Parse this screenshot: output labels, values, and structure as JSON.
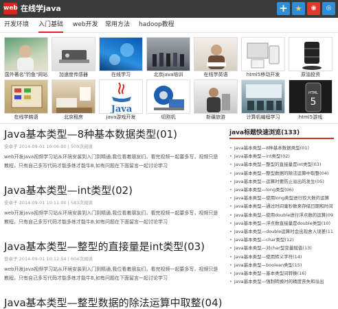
{
  "header": {
    "logo_text": "web",
    "site_title": "在线学java",
    "icons": [
      "plus-icon",
      "star-icon",
      "weibo-icon",
      "qq-icon"
    ]
  },
  "nav": {
    "items": [
      {
        "label": "开发环境",
        "active": false
      },
      {
        "label": "入门基础",
        "active": true
      },
      {
        "label": "web开发",
        "active": false
      },
      {
        "label": "常用方法",
        "active": false
      },
      {
        "label": "hadoop教程",
        "active": false
      }
    ]
  },
  "gallery": {
    "tiles": [
      {
        "label": "国外著名\"钓鱼\"网站"
      },
      {
        "label": "加速度传感器"
      },
      {
        "label": "在线学习"
      },
      {
        "label": "北京java培训"
      },
      {
        "label": "在线学英语"
      },
      {
        "label": "html5移动开发"
      },
      {
        "label": "原油投资"
      },
      {
        "label": "在线学韩语"
      },
      {
        "label": "北京租房"
      },
      {
        "label": "java游戏开发"
      },
      {
        "label": "切割机"
      },
      {
        "label": "新疆旅游"
      },
      {
        "label": "计算机编程学习"
      },
      {
        "label": "html5游戏"
      }
    ]
  },
  "articles": [
    {
      "title": "Java基本类型—8种基本数据类型(01)",
      "meta": "安卓子  2014-09-01 10:06:00  |  500次阅读",
      "excerpt": "web开发java视频学习站从环境安装到入门到精通,我位看着朋友们，看完视频一起要多写，视频只是教程，只有自己多写代码才能多练才能牛B,如有问题在下面留言一起讨论学习"
    },
    {
      "title": "Java基本类型—int类型(02)",
      "meta": "安卓子  2014-09-01 10:11:00  |  583次阅读",
      "excerpt": "web开发java视频学习站从环境安装到入门到精通,我位看着朋友们，看完视频一起要多写，视频只是教程，只有自己多写代码才能多练才能牛B,如有问题在下面留言一起讨论学习"
    },
    {
      "title": "Java基本类型—整型的直接量是int类型(03)",
      "meta": "安卓子  2014-09-01 10:12:54  |  604次阅读",
      "excerpt": "web开发java视频学习站从环境安装到入门到精通,我位看着朋友们，看完视频一起要多写，视频只是教程，只有自己多写代码才能多练才能牛B,如有问题在下面留言一起讨论学习"
    },
    {
      "title": "Java基本类型—整型数据的除法运算中取整(04)",
      "meta": "",
      "excerpt": ""
    }
  ],
  "sidebar": {
    "title": "java标题快速浏览(133)",
    "items": [
      "Java基本类型—8种基本数据类型(01)",
      "Java基本类型—int类型(02)",
      "Java基本类型—整型的直接量是int类型(03)",
      "Java基本类型—整型数据的除法运算中取整(04)",
      "Java基本类型—运算时要防止溢出的发生(05)",
      "Java基本类型—long类型(06)",
      "Java基本类型—使用long类型进行较大数的运算",
      "Java基本类型—通过时间毫秒数来存储日期和时间",
      "Java基本类型—使用double进行浮点数的运算(09)",
      "Java基本类型—浮点数直接量是double类型(10)",
      "Java基本类型—double运算时会出现舍入误差(11)",
      "Java基本类型—char类型(12)",
      "Java基本类型—对char型变量赋值(13)",
      "Java基本类型—使用转义字符(14)",
      "Java基本类型—boolean类型(15)",
      "Java基本类型—基本类型间转换(16)",
      "Java基本类型—强制转换时的精度丧失和溢出"
    ]
  },
  "colors": {
    "accent": "#d9261c",
    "topbar": "#3a3a3a",
    "icon_blue": "#2e8fd8"
  }
}
